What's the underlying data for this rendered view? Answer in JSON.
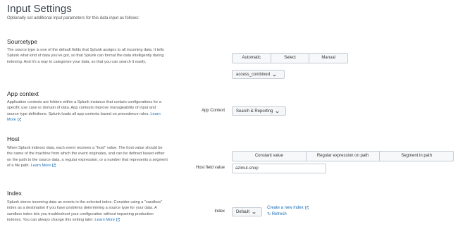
{
  "header": {
    "title": "Input Settings",
    "subtitle": "Optionally set additional input parameters for this data input as follows:"
  },
  "sourcetype": {
    "title": "Sourcetype",
    "description": "The source type is one of the default fields that Splunk assigns to all incoming data. It tells Splunk what kind of data you've got, so that Splunk can format the data intelligently during indexing. And it's a way to categorize your data, so that you can search it easily.",
    "options": [
      "Automatic",
      "Select",
      "Manual"
    ],
    "selected_value": "access_combined"
  },
  "app_context": {
    "title": "App context",
    "description": "Application contexts are folders within a Splunk instance that contain configurations for a specific use case or domain of data. App contexts improve manageability of input and source type definitions. Splunk loads all app contexts based on precedence rules.",
    "learn_more": "Learn More",
    "field_label": "App Context",
    "selected_value": "Search & Reporting"
  },
  "host": {
    "title": "Host",
    "description": "When Splunk indexes data, each event receives a \"host\" value. The host value should be the name of the machine from which the event originates, and can be defined based either on the path to the source data, a regular expression, or a number that represents a segment of a file path.",
    "learn_more": "Learn More",
    "options": [
      "Constant value",
      "Regular expression on path",
      "Segment in path"
    ],
    "field_label": "Host field value",
    "field_value": "azimut-shop"
  },
  "index": {
    "title": "Index",
    "description": "Splunk stores incoming data as events in the selected index. Consider using a \"sandbox\" index as a destination if you have problems determining a source type for your data. A sandbox index lets you troubleshoot your configuration without impacting production indexes. You can always change this setting later.",
    "learn_more": "Learn More",
    "field_label": "Index",
    "selected_value": "Default",
    "create_link": "Create a new index",
    "refresh_link": "Refresh"
  },
  "icons": {
    "external_link": "external-link-icon",
    "dropdown": "chevron-down-icon",
    "refresh": "refresh-icon"
  },
  "colors": {
    "link": "#1a6eb5",
    "border": "#c3cbd4",
    "button_bg": "#f5f6f8"
  }
}
